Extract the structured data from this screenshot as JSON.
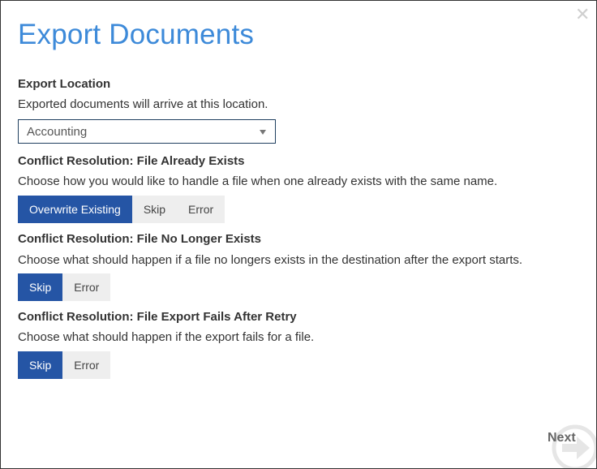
{
  "dialog": {
    "title": "Export Documents",
    "close_icon": "close-icon"
  },
  "export_location": {
    "title": "Export Location",
    "description": "Exported documents will arrive at this location.",
    "selected": "Accounting"
  },
  "file_already_exists": {
    "title": "Conflict Resolution: File Already Exists",
    "description": "Choose how you would like to handle a file when one already exists with the same name.",
    "options": [
      "Overwrite Existing",
      "Skip",
      "Error"
    ],
    "selected": "Overwrite Existing"
  },
  "file_no_longer_exists": {
    "title": "Conflict Resolution: File No Longer Exists",
    "description": "Choose what should happen if a file no longers exists in the destination after the export starts.",
    "options": [
      "Skip",
      "Error"
    ],
    "selected": "Skip"
  },
  "export_fails": {
    "title": "Conflict Resolution: File Export Fails After Retry",
    "description": "Choose what should happen if the export fails for a file.",
    "options": [
      "Skip",
      "Error"
    ],
    "selected": "Skip"
  },
  "footer": {
    "next_label": "Next",
    "next_icon": "arrow-right-circle-icon"
  },
  "colors": {
    "title": "#3d8ad9",
    "active_button": "#2555a5",
    "inactive_button": "#eeeeee"
  }
}
